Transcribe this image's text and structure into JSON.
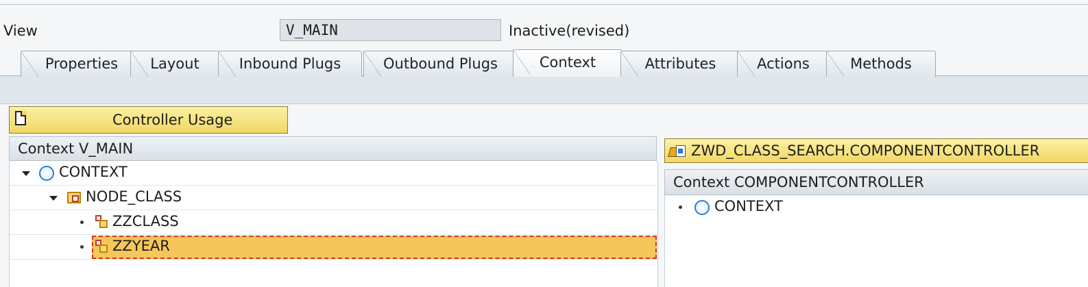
{
  "view": {
    "label": "View",
    "name": "V_MAIN",
    "status": "Inactive(revised)"
  },
  "tabs": [
    {
      "label": "Properties"
    },
    {
      "label": "Layout"
    },
    {
      "label": "Inbound Plugs"
    },
    {
      "label": "Outbound Plugs"
    },
    {
      "label": "Context",
      "active": true
    },
    {
      "label": "Attributes"
    },
    {
      "label": "Actions"
    },
    {
      "label": "Methods"
    }
  ],
  "toolbar": {
    "controller_usage_label": "Controller Usage",
    "controller_usage_icon": "document-icon"
  },
  "left_panel": {
    "header": "Context V_MAIN",
    "tree": [
      {
        "label": "CONTEXT",
        "icon": "context-circle-icon",
        "expanded": true
      },
      {
        "label": "NODE_CLASS",
        "icon": "context-node-icon",
        "expanded": true
      },
      {
        "label": "ZZCLASS",
        "icon": "context-attribute-icon"
      },
      {
        "label": "ZZYEAR",
        "icon": "context-attribute-icon",
        "selected": true
      }
    ]
  },
  "right_panel": {
    "controller": "ZWD_CLASS_SEARCH.COMPONENTCONTROLLER",
    "controller_icon": "component-controller-icon",
    "header": "Context COMPONENTCONTROLLER",
    "tree": [
      {
        "label": "CONTEXT",
        "icon": "context-circle-icon"
      }
    ]
  },
  "colors": {
    "button_yellow": "#f1d765",
    "selection": "#f5c65a",
    "selection_border": "#cf3326",
    "context_circle": "#2a7fd4"
  }
}
